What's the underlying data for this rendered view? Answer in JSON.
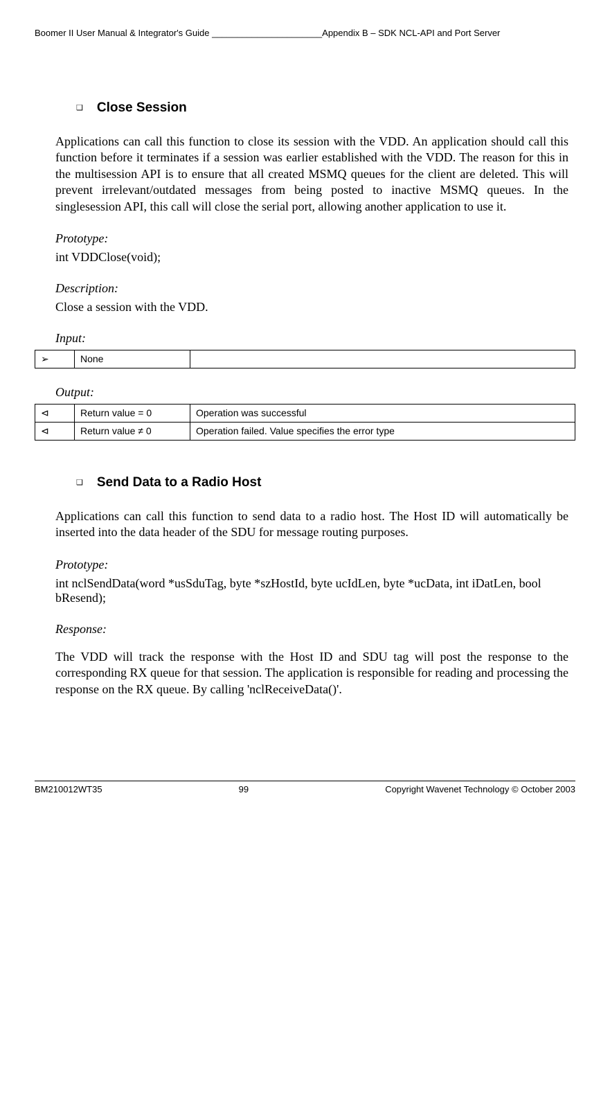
{
  "header": {
    "left": "Boomer II User Manual & Integrator's Guide ______________________",
    "right": "Appendix B – SDK NCL-API and Port Server"
  },
  "sections": [
    {
      "title": "Close Session",
      "intro": "Applications can call this function to close its session with the VDD. An application should call this function before it terminates if a session was earlier established with the VDD.  The reason for this in the multisession API is to ensure that all created MSMQ queues for the client are deleted. This will prevent irrelevant/outdated messages from being posted to inactive MSMQ queues.  In the singlesession API, this call will close the serial port, allowing another application to use it.",
      "prototype_label": "Prototype:",
      "prototype": "int VDDClose(void);",
      "description_label": "Description:",
      "description": "Close a session with the VDD.",
      "input_label": "Input",
      "input_rows": [
        {
          "arrow": "➢",
          "label": "None",
          "desc": ""
        }
      ],
      "output_label": "Output",
      "output_rows": [
        {
          "arrow": "⊲",
          "label": "Return value = 0",
          "desc": "Operation was successful"
        },
        {
          "arrow": "⊲",
          "label": "Return value  ≠ 0",
          "desc": "Operation failed. Value specifies the error type"
        }
      ]
    },
    {
      "title": "Send Data to a Radio Host",
      "intro": "Applications can call this function to send data to a radio host. The Host ID will automatically be inserted into the data header of the SDU for message routing purposes.",
      "prototype_label": "Prototype:",
      "prototype": "int nclSendData(word *usSduTag, byte *szHostId, byte ucIdLen, byte *ucData, int iDatLen, bool bResend);",
      "response_label": "Response",
      "response": "The VDD will track the response with the Host ID and SDU tag will post the response to the corresponding RX queue for that session. The application is responsible for reading and processing the response on the RX queue. By calling 'nclReceiveData()'."
    }
  ],
  "footer": {
    "left": "BM210012WT35",
    "center": "99",
    "right": "Copyright Wavenet Technology © October 2003"
  }
}
